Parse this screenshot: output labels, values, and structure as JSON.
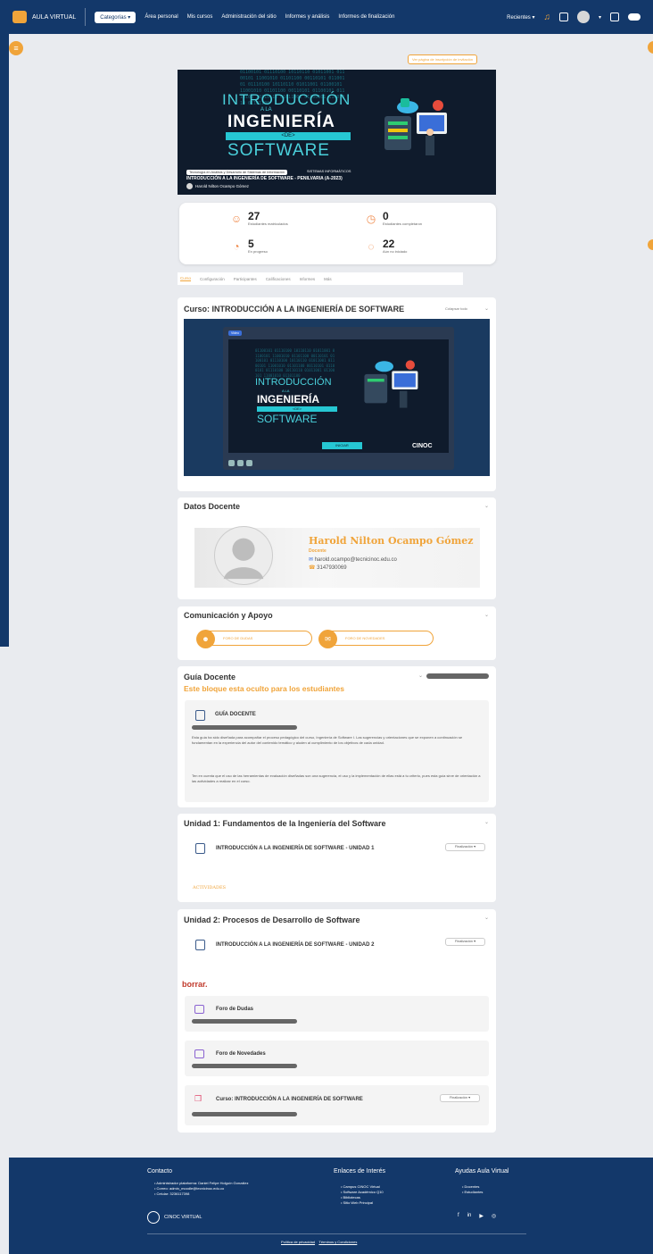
{
  "topnav": {
    "brand": "AULA VIRTUAL",
    "category": "Categorías",
    "links": [
      "Área personal",
      "Mis cursos",
      "Administración del sitio",
      "Informes y análisis",
      "Informes de finalización"
    ],
    "recent": "Recientes"
  },
  "enroll_link": "Ver página de inscripción de invitación",
  "hero": {
    "code": "01100101 01110100 10110110 01011001 01100101 11001010 01101100 00110101 01100101 01110100 10110110 01011001 01100101 11001010 01101100 00110101 01100101 01110100 10110110 01011001 01100101 11001010 01101100",
    "line1": "INTRODUCCIÓN",
    "line2": "A LA",
    "line3": "INGENIERÍA",
    "line4": "<DE>",
    "line5": "SOFTWARE",
    "category": "Tecnología en Análisis y Desarrollo de Sistemas de Información",
    "category2": "SISTEMAS INFORMÁTICOS",
    "course_title": "INTRODUCCIÓN A LA INGENIERÍA DE SOFTWARE - PENILVARIA (A-2023)",
    "teacher": "Harold Nilton Ocampo Gómez"
  },
  "stats": [
    {
      "value": "27",
      "label": "Estudiantes matriculados",
      "icon": "users-icon"
    },
    {
      "value": "0",
      "label": "Estudiantes completaron",
      "icon": "clock-icon"
    },
    {
      "value": "5",
      "label": "En progreso",
      "icon": "progress-icon"
    },
    {
      "value": "22",
      "label": "Aún no iniciado",
      "icon": "not-started-icon"
    }
  ],
  "tabs": [
    "Curso",
    "Configuración",
    "Participantes",
    "Calificaciones",
    "Informes",
    "Más"
  ],
  "course_section": {
    "title": "Curso: INTRODUCCIÓN A LA INGENIERÍA DE SOFTWARE",
    "collapse": "Colapsar todo",
    "video_badge": "Video",
    "video_button": "INICIAR",
    "video_logo": "CINOC"
  },
  "teacher_section": {
    "title": "Datos Docente",
    "name": "Harold Nilton Ocampo Gómez",
    "role": "Docente",
    "email": "harold.ocampo@tecnicinoc.edu.co",
    "phone": "3147930069"
  },
  "support_section": {
    "title": "Comunicación y Apoyo",
    "forum_doubts": "FORO DE DUDAS",
    "forum_news": "FORO DE NOVEDADES"
  },
  "guide_section": {
    "title": "Guía Docente",
    "hidden_notice": "Este bloque esta oculto para los estudiantes",
    "activity": "GUÍA DOCENTE",
    "desc1": "Esta guía ha sido diseñada para acompañar el proceso pedagógico del curso, Ingeniería de Software I. Las sugerencias y orientaciones que se exponen a continuación se fundamentan en la experiencia del autor del contenido temático y aluden al cumplimiento de los objetivos de cada unidad.",
    "desc2": "Ten en cuenta que el uso de las herramientas de evaluación diseñadas son una sugerencia, el uso y la implementación de ellas está a tu criterio, pues esta guía sirve de orientación a las actividades a realizar en el curso."
  },
  "unit1": {
    "title": "Unidad 1: Fundamentos de la Ingeniería del Software",
    "activity": "INTRODUCCIÓN A LA INGENIERÍA DE SOFTWARE - UNIDAD 1",
    "completion": "Finalización",
    "link": "ACTIVIDADES"
  },
  "unit2": {
    "title": "Unidad 2: Procesos de Desarrollo de Software",
    "activity": "INTRODUCCIÓN A LA INGENIERÍA DE SOFTWARE - UNIDAD 2",
    "completion": "Finalización",
    "red_text": "borrar.",
    "forum1": "Foro de Dudas",
    "forum2": "Foro de Novedades",
    "course_link": "Curso: INTRODUCCIÓN A LA INGENIERÍA DE SOFTWARE",
    "completion2": "Finalización"
  },
  "footer": {
    "contact_title": "Contacto",
    "contact_items": [
      "Administrador plataforma: Daniel Felipe Holguín González",
      "Correo: admin_moodle@tecnicinoc.edu.co",
      "Celular: 3236117398"
    ],
    "interest_title": "Enlaces de Interés",
    "interest_items": [
      "Campus CINOC Virtual",
      "Software Académico Q10",
      "Bibliotecas",
      "Sitio Web Principal"
    ],
    "help_title": "Ayudas Aula Virtual",
    "help_items": [
      "Docentes",
      "Estudiantes"
    ],
    "brand": "CINOC VIRTUAL",
    "privacy": "Política de privacidad",
    "terms": "Términos y Condiciones"
  },
  "colors": {
    "navy": "#13386a",
    "accent": "#f0a43a",
    "teal": "#26c7d3"
  }
}
